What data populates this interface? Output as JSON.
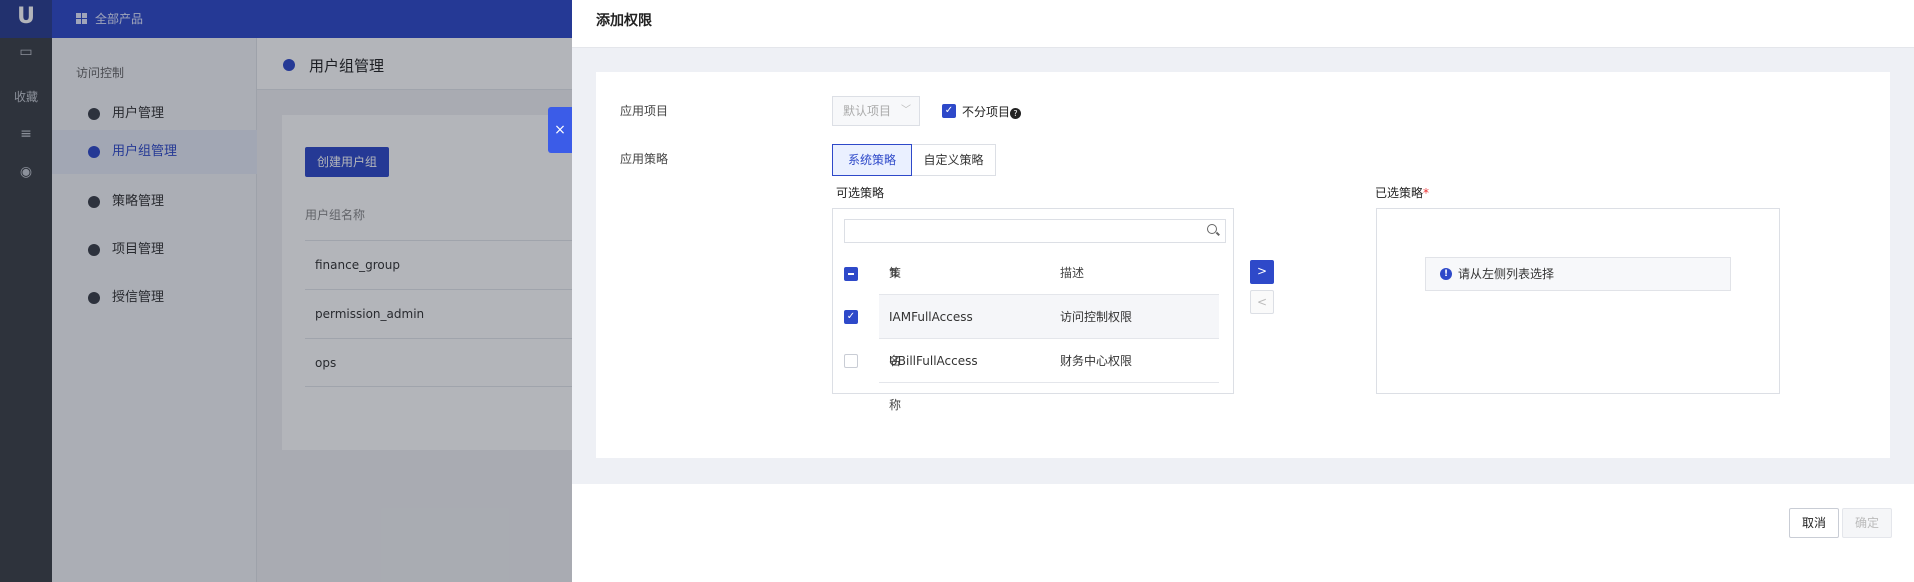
{
  "rail": {
    "logo": "U",
    "fav_label": "收藏"
  },
  "topbar": {
    "products_label": "全部产品"
  },
  "sidebar": {
    "section": "访问控制",
    "items": [
      {
        "label": "用户管理",
        "active": false
      },
      {
        "label": "用户组管理",
        "active": true
      },
      {
        "label": "策略管理",
        "active": false
      },
      {
        "label": "项目管理",
        "active": false
      },
      {
        "label": "授信管理",
        "active": false
      }
    ]
  },
  "page": {
    "title": "用户组管理",
    "create_button": "创建用户组",
    "table_header": "用户组名称",
    "rows": [
      "finance_group",
      "permission_admin",
      "ops"
    ]
  },
  "drawer": {
    "close_icon": "×",
    "title": "添加权限",
    "project_label": "应用项目",
    "project_select": "默认项目",
    "no_project_label": "不分项目",
    "help_icon": "?",
    "policy_label": "应用策略",
    "tabs": [
      "系统策略",
      "自定义策略"
    ],
    "available_title": "可选策略",
    "selected_title": "已选策略",
    "required_mark": "*",
    "search_placeholder": "",
    "columns": {
      "name": "策略名称",
      "desc": "描述",
      "sort_icon": "⇅"
    },
    "policies": [
      {
        "name": "IAMFullAccess",
        "desc": "访问控制权限",
        "checked": true
      },
      {
        "name": "UBillFullAccess",
        "desc": "财务中心权限",
        "checked": false
      }
    ],
    "move_right": ">",
    "move_left": "<",
    "empty_hint": "请从左侧列表选择",
    "info_icon": "!",
    "cancel": "取消",
    "confirm": "确定"
  },
  "colors": {
    "brand": "#2e49c9",
    "accent": "#3b5ce8"
  }
}
